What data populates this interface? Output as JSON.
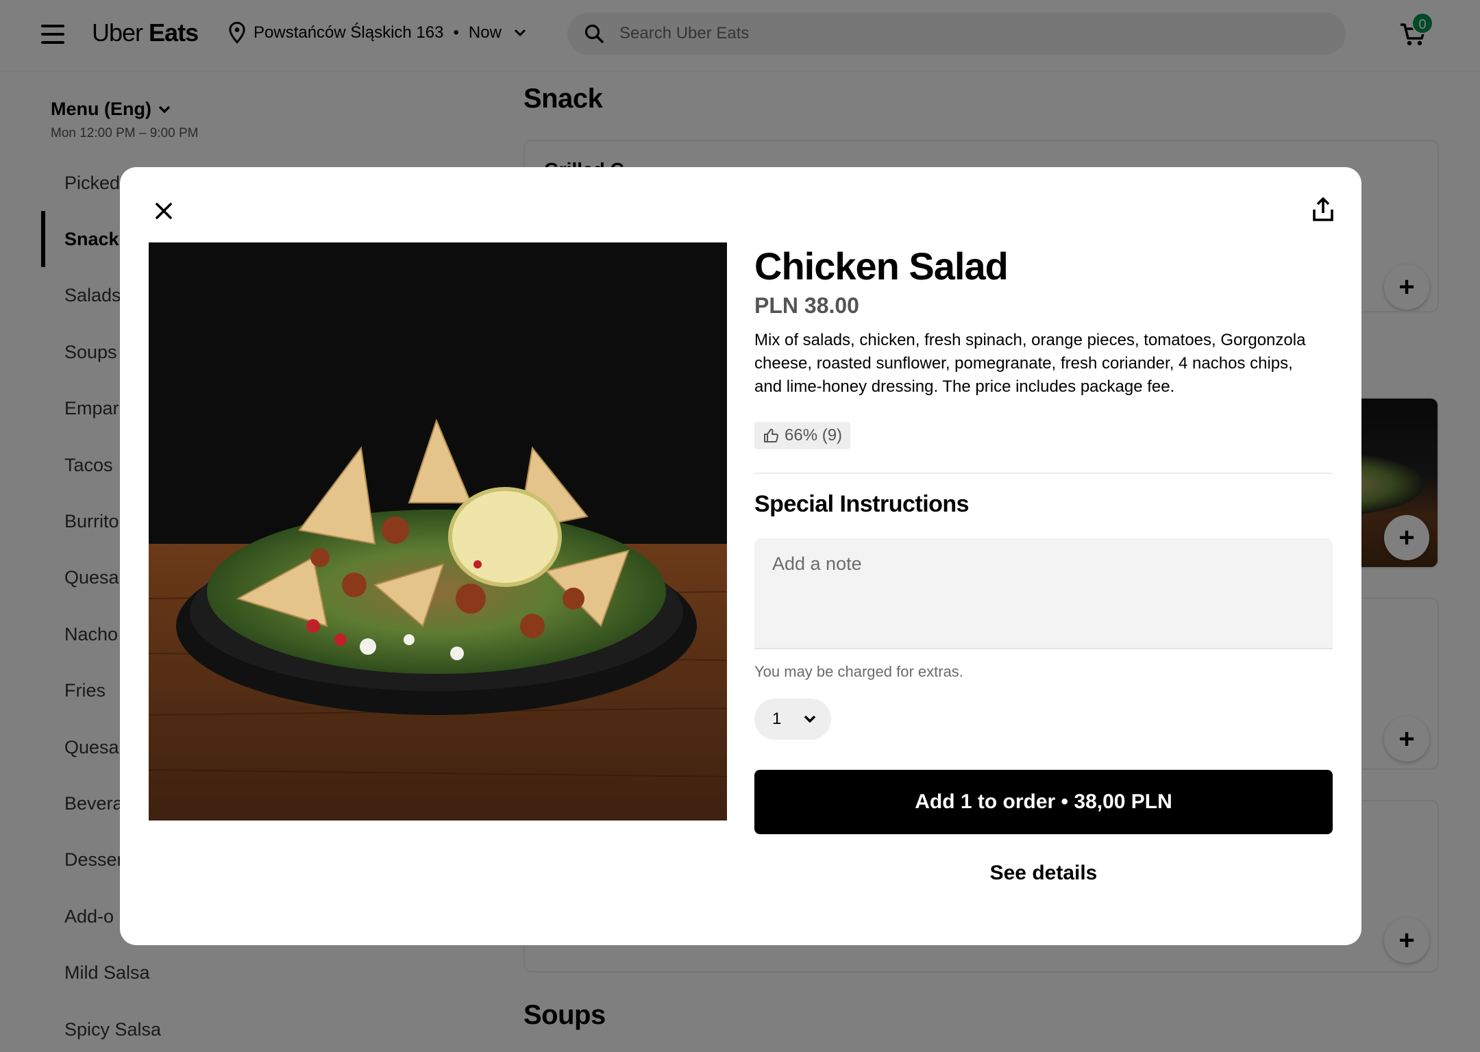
{
  "header": {
    "logo_light": "Uber",
    "logo_bold": "Eats",
    "address": "Powstańców Śląskich 163",
    "time": "Now",
    "search_placeholder": "Search Uber Eats",
    "cart_count": "0",
    "badge_color": "#05944f"
  },
  "sidebar": {
    "menu_title": "Menu (Eng)",
    "hours": "Mon 12:00 PM – 9:00 PM",
    "items": [
      {
        "label": "Picked"
      },
      {
        "label": "Snack"
      },
      {
        "label": "Salads"
      },
      {
        "label": "Soups"
      },
      {
        "label": "Empar"
      },
      {
        "label": "Tacos"
      },
      {
        "label": "Burrito"
      },
      {
        "label": "Quesa"
      },
      {
        "label": "Nacho"
      },
      {
        "label": "Fries"
      },
      {
        "label": "Quesa"
      },
      {
        "label": "Bevera"
      },
      {
        "label": "Desser"
      },
      {
        "label": "Add-o"
      },
      {
        "label": "Mild Salsa"
      },
      {
        "label": "Spicy Salsa"
      }
    ],
    "active_index": 1
  },
  "main": {
    "section_snack": "Snack",
    "section_soups": "Soups",
    "first_card_title": "Grilled C"
  },
  "modal": {
    "title": "Chicken Salad",
    "price": "PLN 38.00",
    "description": "Mix of salads, chicken, fresh spinach, orange pieces, tomatoes, Gorgonzola cheese, roasted sunflower, pomegranate, fresh coriander, 4 nachos chips, and lime-honey dressing. The price includes package fee.",
    "rating": "66% (9)",
    "special_instructions_title": "Special Instructions",
    "note_placeholder": "Add a note",
    "extras_hint": "You may be charged for extras.",
    "quantity": "1",
    "add_button": "Add 1 to order • 38,00 PLN",
    "details_button": "See details"
  },
  "icons": {
    "menu": "hamburger-icon",
    "location": "location-pin-icon",
    "search": "search-icon",
    "cart": "cart-icon",
    "close": "close-icon",
    "share": "share-icon",
    "rating": "thumbs-up-icon",
    "add": "plus-icon",
    "chevron": "chevron-down-icon"
  }
}
